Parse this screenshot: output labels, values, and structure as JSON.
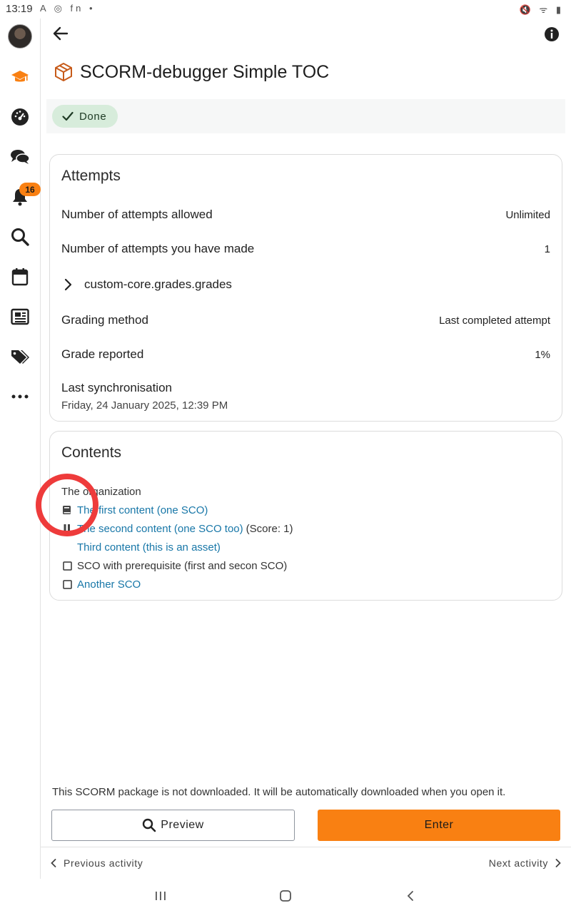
{
  "status_bar": {
    "time": "13:19",
    "notification_icons": "A ◎ fn •",
    "system_icons": "🔇 ᯤ ▮"
  },
  "rail": {
    "items": [
      {
        "name": "avatar"
      },
      {
        "name": "graduation-cap-icon",
        "color": "#f98012"
      },
      {
        "name": "dashboard-icon"
      },
      {
        "name": "chat-icon"
      },
      {
        "name": "bell-icon",
        "badge": "16"
      },
      {
        "name": "search-icon"
      },
      {
        "name": "calendar-icon"
      },
      {
        "name": "news-icon"
      },
      {
        "name": "tags-icon"
      },
      {
        "name": "more-icon"
      }
    ]
  },
  "header": {
    "title": "SCORM-debugger Simple TOC"
  },
  "completion": {
    "label": "Done"
  },
  "attempts": {
    "title": "Attempts",
    "allowed_label": "Number of attempts allowed",
    "allowed_value": "Unlimited",
    "made_label": "Number of attempts you have made",
    "made_value": "1",
    "grades_label": "custom-core.grades.grades",
    "grading_method_label": "Grading method",
    "grading_method_value": "Last completed attempt",
    "grade_reported_label": "Grade reported",
    "grade_reported_value": "1%",
    "last_sync_label": "Last synchronisation",
    "last_sync_value": "Friday, 24 January 2025, 12:39 PM"
  },
  "contents": {
    "title": "Contents",
    "organization": "The organization",
    "items": [
      {
        "text": "The first content (one SCO)",
        "suffix": "",
        "icon": "book-icon",
        "link": true
      },
      {
        "text": "The second content (one SCO too)",
        "suffix": "(Score: 1)",
        "icon": "pause-icon",
        "link": true
      },
      {
        "text": "Third content (this is an asset)",
        "suffix": "",
        "icon": "",
        "link": true
      },
      {
        "text": "SCO with prerequisite (first and secon SCO)",
        "suffix": "",
        "icon": "checkbox-icon",
        "link": false
      },
      {
        "text": "Another SCO",
        "suffix": "",
        "icon": "checkbox-icon",
        "link": true
      }
    ]
  },
  "footer": {
    "download_note": "This SCORM package is not downloaded. It will be automatically downloaded when you open it.",
    "preview_label": "Preview",
    "enter_label": "Enter",
    "previous_label": "Previous activity",
    "next_label": "Next activity"
  },
  "colors": {
    "accent": "#f98012",
    "link": "#1877a8",
    "done_chip": "#d7ecdb",
    "annotation": "#ee3b3b"
  }
}
